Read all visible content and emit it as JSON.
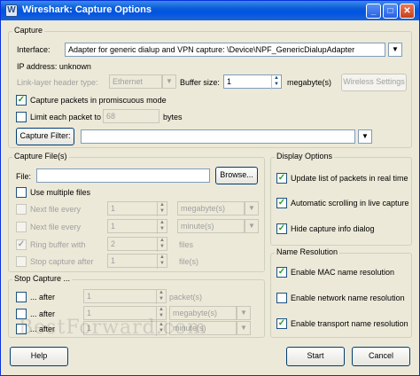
{
  "window": {
    "title": "Wireshark: Capture Options",
    "minimize": "_",
    "maximize": "□",
    "close": "✕"
  },
  "capture": {
    "group_title": "Capture",
    "interface_label": "Interface:",
    "interface_value": "Adapter for generic dialup and VPN capture: \\Device\\NPF_GenericDialupAdapter",
    "ip_address": "IP address: unknown",
    "link_layer_label": "Link-layer header type:",
    "link_layer_value": "Ethernet",
    "buffer_label": "Buffer size:",
    "buffer_value": "1",
    "buffer_unit": "megabyte(s)",
    "wireless_button": "Wireless Settings",
    "promiscuous_label": "Capture packets in promiscuous mode",
    "limit_label": "Limit each packet to",
    "limit_value": "68",
    "limit_unit": "bytes",
    "filter_button": "Capture Filter:",
    "filter_value": ""
  },
  "capture_files": {
    "group_title": "Capture File(s)",
    "file_label": "File:",
    "file_value": "",
    "browse_button": "Browse...",
    "multiple_label": "Use multiple files",
    "next_file_size_label": "Next file every",
    "next_file_size_value": "1",
    "next_file_size_unit": "megabyte(s)",
    "next_file_time_label": "Next file every",
    "next_file_time_value": "1",
    "next_file_time_unit": "minute(s)",
    "ring_buffer_label": "Ring buffer with",
    "ring_buffer_value": "2",
    "ring_buffer_unit": "files",
    "stop_after_label": "Stop capture after",
    "stop_after_value": "1",
    "stop_after_unit": "file(s)"
  },
  "stop_capture": {
    "group_title": "Stop Capture ...",
    "packets_label": "... after",
    "packets_value": "1",
    "packets_unit": "packet(s)",
    "size_label": "... after",
    "size_value": "1",
    "size_unit": "megabyte(s)",
    "time_label": "... after",
    "time_value": "1",
    "time_unit": "minute(s)"
  },
  "display_options": {
    "group_title": "Display Options",
    "update_label": "Update list of packets in real time",
    "autoscroll_label": "Automatic scrolling in live capture",
    "hide_info_label": "Hide capture info dialog"
  },
  "name_resolution": {
    "group_title": "Name Resolution",
    "mac_label": "Enable MAC name resolution",
    "network_label": "Enable network name resolution",
    "transport_label": "Enable transport name resolution"
  },
  "buttons": {
    "help": "Help",
    "start": "Start",
    "cancel": "Cancel"
  },
  "watermark": "BestForward.com",
  "glyphs": {
    "check": "✓",
    "arrow": "▼",
    "up": "▲",
    "down": "▼"
  }
}
